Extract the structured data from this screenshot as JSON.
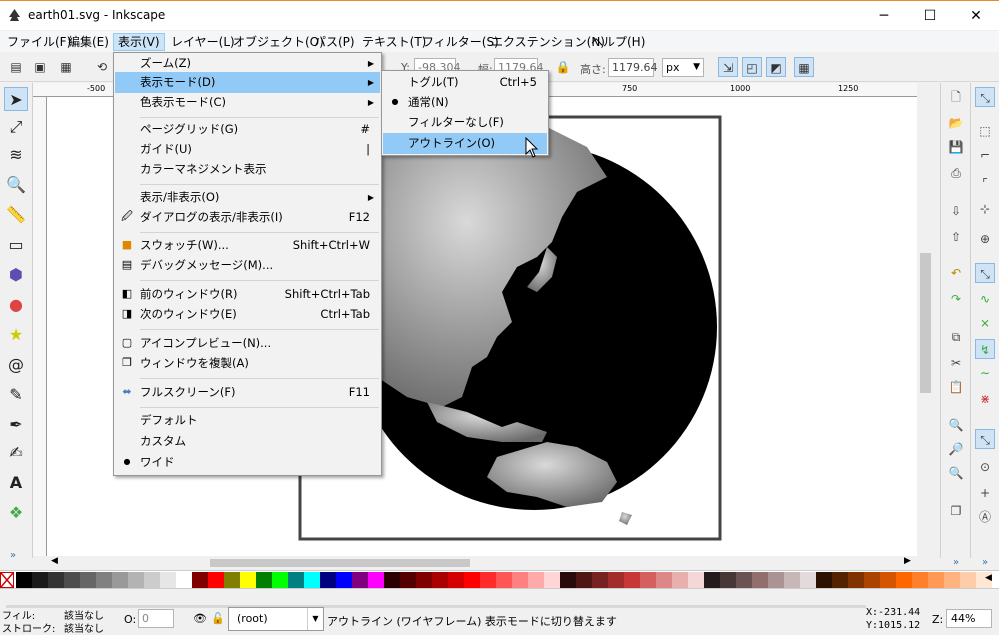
{
  "window": {
    "title": "earth01.svg - Inkscape",
    "minimize": "─",
    "maximize": "☐",
    "close": "✕"
  },
  "menubar": [
    "ファイル(F)",
    "編集(E)",
    "表示(V)",
    "レイヤー(L)",
    "オブジェクト(O)",
    "パス(P)",
    "テキスト(T)",
    "フィルター(S)",
    "エクステンション(N)",
    "ヘルプ(H)"
  ],
  "toolbar": {
    "y_label": "Y:",
    "y_value": "-98.304",
    "w_label": "幅:",
    "w_value": "1179.64",
    "h_label": "高さ:",
    "h_value": "1179.64",
    "unit": "px"
  },
  "ruler": {
    "labels": [
      "-500",
      "750",
      "1000",
      "1250"
    ]
  },
  "view_menu": {
    "items": [
      {
        "label": "ズーム(Z)",
        "shortcut": "",
        "submenu": true
      },
      {
        "label": "表示モード(D)",
        "shortcut": "",
        "submenu": true
      },
      {
        "label": "色表示モード(C)",
        "shortcut": "",
        "submenu": true
      },
      {
        "label": "ページグリッド(G)",
        "shortcut": "#"
      },
      {
        "label": "ガイド(U)",
        "shortcut": "|"
      },
      {
        "label": "カラーマネジメント表示",
        "shortcut": ""
      },
      {
        "label": "表示/非表示(O)",
        "shortcut": "",
        "submenu": true
      },
      {
        "label": "ダイアログの表示/非表示(I)",
        "shortcut": "F12"
      },
      {
        "label": "スウォッチ(W)...",
        "shortcut": "Shift+Ctrl+W"
      },
      {
        "label": "デバッグメッセージ(M)...",
        "shortcut": ""
      },
      {
        "label": "前のウィンドウ(R)",
        "shortcut": "Shift+Ctrl+Tab"
      },
      {
        "label": "次のウィンドウ(E)",
        "shortcut": "Ctrl+Tab"
      },
      {
        "label": "アイコンプレビュー(N)...",
        "shortcut": ""
      },
      {
        "label": "ウィンドウを複製(A)",
        "shortcut": ""
      },
      {
        "label": "フルスクリーン(F)",
        "shortcut": "F11"
      },
      {
        "label": "デフォルト",
        "shortcut": ""
      },
      {
        "label": "カスタム",
        "shortcut": ""
      },
      {
        "label": "ワイド",
        "shortcut": ""
      }
    ]
  },
  "display_mode_submenu": {
    "items": [
      {
        "label": "トグル(T)",
        "shortcut": "Ctrl+5"
      },
      {
        "label": "通常(N)",
        "shortcut": ""
      },
      {
        "label": "フィルターなし(F)",
        "shortcut": ""
      },
      {
        "label": "アウトライン(O)",
        "shortcut": ""
      }
    ]
  },
  "statusbar": {
    "fill_label": "フィル:",
    "fill_value": "該当なし",
    "stroke_label": "ストローク:",
    "stroke_value": "該当なし",
    "opacity_label": "O:",
    "opacity_value": "0",
    "layer": "(root)",
    "message": "アウトライン (ワイヤフレーム) 表示モードに切り替えます",
    "x_coord": "X:-231.44",
    "y_coord": "Y:1015.12",
    "z_label": "Z:",
    "zoom": "44%"
  },
  "colors": {
    "menu_highlight": "#91c9f7",
    "accent": "#cfe3f6",
    "palette": [
      "#000000",
      "#1a1a1a",
      "#333333",
      "#4d4d4d",
      "#666666",
      "#808080",
      "#999999",
      "#b3b3b3",
      "#cccccc",
      "#e6e6e6",
      "#ffffff",
      "#800000",
      "#ff0000",
      "#808000",
      "#ffff00",
      "#008000",
      "#00ff00",
      "#008080",
      "#00ffff",
      "#000080",
      "#0000ff",
      "#800080",
      "#ff00ff",
      "#2b0000",
      "#550000",
      "#800000",
      "#aa0000",
      "#d40000",
      "#ff0000",
      "#ff2a2a",
      "#ff5555",
      "#ff8080",
      "#ffaaaa",
      "#ffd5d5",
      "#280b0b",
      "#501616",
      "#782121",
      "#a02c2c",
      "#c83737",
      "#d35f5f",
      "#de8787",
      "#e9afaf",
      "#f4d7d7",
      "#241c1c",
      "#483737",
      "#6c5353",
      "#916f6f",
      "#ac9393",
      "#c8b7b7",
      "#e3dbdb",
      "#2b1100",
      "#552200",
      "#803300",
      "#aa4400",
      "#d45500",
      "#ff6600",
      "#ff7f2a",
      "#ff9955",
      "#ffb380",
      "#ffccaa",
      "#ffe6d5"
    ]
  }
}
